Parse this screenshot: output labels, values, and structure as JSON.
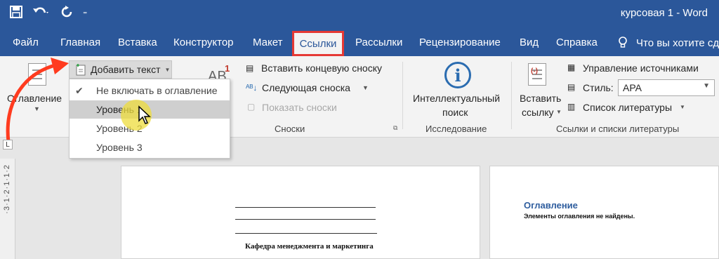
{
  "titlebar": {
    "doc_title": "курсовая 1  -  Word",
    "qat": {
      "save_icon": "save-icon",
      "undo_icon": "undo-icon",
      "redo_icon": "redo-icon"
    }
  },
  "tabs": [
    {
      "label": "Файл"
    },
    {
      "label": "Главная"
    },
    {
      "label": "Вставка"
    },
    {
      "label": "Конструктор"
    },
    {
      "label": "Макет"
    },
    {
      "label": "Ссылки"
    },
    {
      "label": "Рассылки"
    },
    {
      "label": "Рецензирование"
    },
    {
      "label": "Вид"
    },
    {
      "label": "Справка"
    }
  ],
  "tellme": "Что вы хотите сде",
  "ribbon": {
    "toc": {
      "label": "Оглавление",
      "add_text": "Добавить текст"
    },
    "footnotes": {
      "insert_endnote": "Вставить концевую сноску",
      "next_footnote": "Следующая сноска",
      "show_notes": "Показать сноски",
      "group": "Сноски",
      "ab_label": "AB",
      "superscript": "1"
    },
    "research": {
      "smart_lookup_1": "Интеллектуальный",
      "smart_lookup_2": "поиск",
      "group": "Исследование"
    },
    "citations": {
      "insert_1": "Вставить",
      "insert_2": "ссылку",
      "manage": "Управление источниками",
      "style_label": "Стиль:",
      "style_value": "APA",
      "bibliography": "Список литературы",
      "group": "Ссылки и списки литературы"
    }
  },
  "dropdown": {
    "items": [
      {
        "label": "Не включать в оглавление",
        "checked": true
      },
      {
        "label": "Уровень 1",
        "hover": true
      },
      {
        "label": "Уровень 2"
      },
      {
        "label": "Уровень 3"
      }
    ]
  },
  "ruler": {
    "marks": "·3·1·2·1·1·2"
  },
  "pages": {
    "page1": {
      "dept": "Кафедра менеджмента и маркетинга"
    },
    "page2": {
      "toc_title": "Оглавление",
      "toc_msg": "Элементы оглавления не найдены."
    }
  },
  "colors": {
    "brand": "#2b579a",
    "highlight_border": "#e53935",
    "arrow": "#ff3b1f"
  }
}
